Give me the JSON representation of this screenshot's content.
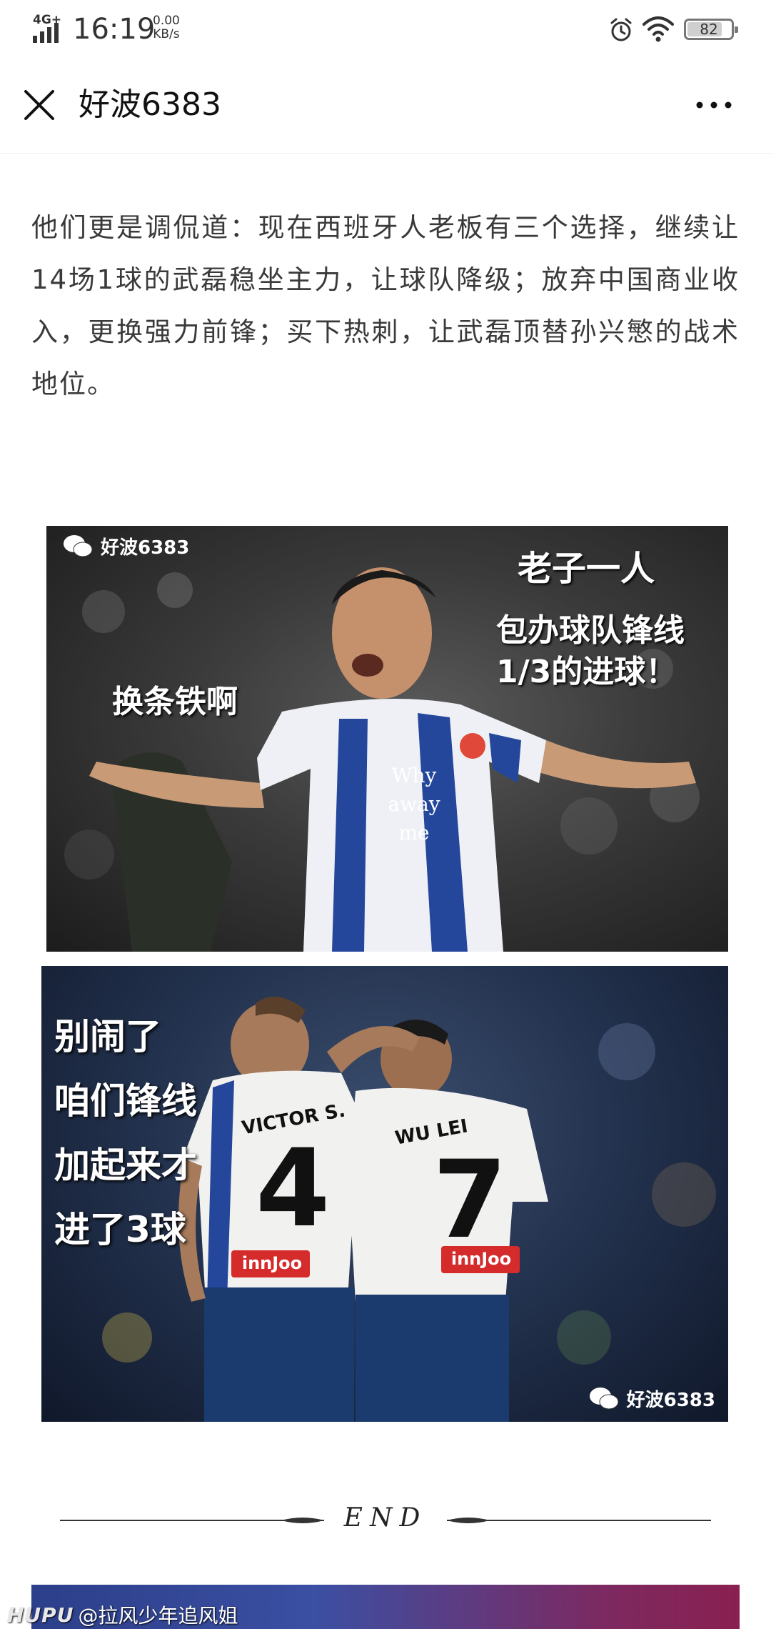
{
  "status_bar": {
    "network": "4G+",
    "time": "16:19",
    "speed_value": "0.00",
    "speed_unit": "KB/s",
    "battery": "82",
    "battery_level": 0.82
  },
  "navbar": {
    "title": "好波6383",
    "close_icon": "close-icon",
    "more_icon": "more-icon"
  },
  "article": {
    "paragraph": "他们更是调侃道：现在西班牙人老板有三个选择，继续让14场1球的武磊稳坐主力，让球队降级；放弃中国商业收入，更换强力前锋；买下热刺，让武磊顶替孙兴慜的战术地位。"
  },
  "meme1": {
    "watermark": "好波6383",
    "caption_top_right_1": "老子一人",
    "caption_top_right_2": "包办球队锋线",
    "caption_top_right_3": "1/3的进球！",
    "caption_left": "换条铁啊",
    "shirt_line1": "Why",
    "shirt_line2": "away",
    "shirt_line3": "me"
  },
  "meme2": {
    "caption_lines": [
      "别闹了",
      "咱们锋线",
      "加起来才",
      "进了3球"
    ],
    "player1_name": "VICTOR S.",
    "player1_number": "4",
    "player2_name": "WU LEI",
    "player2_number": "7",
    "sponsor": "innJoo",
    "watermark": "好波6383"
  },
  "end_divider": {
    "text": "END"
  },
  "footer": {
    "logo": "HUPU",
    "handle": "@拉风少年追风姐"
  }
}
